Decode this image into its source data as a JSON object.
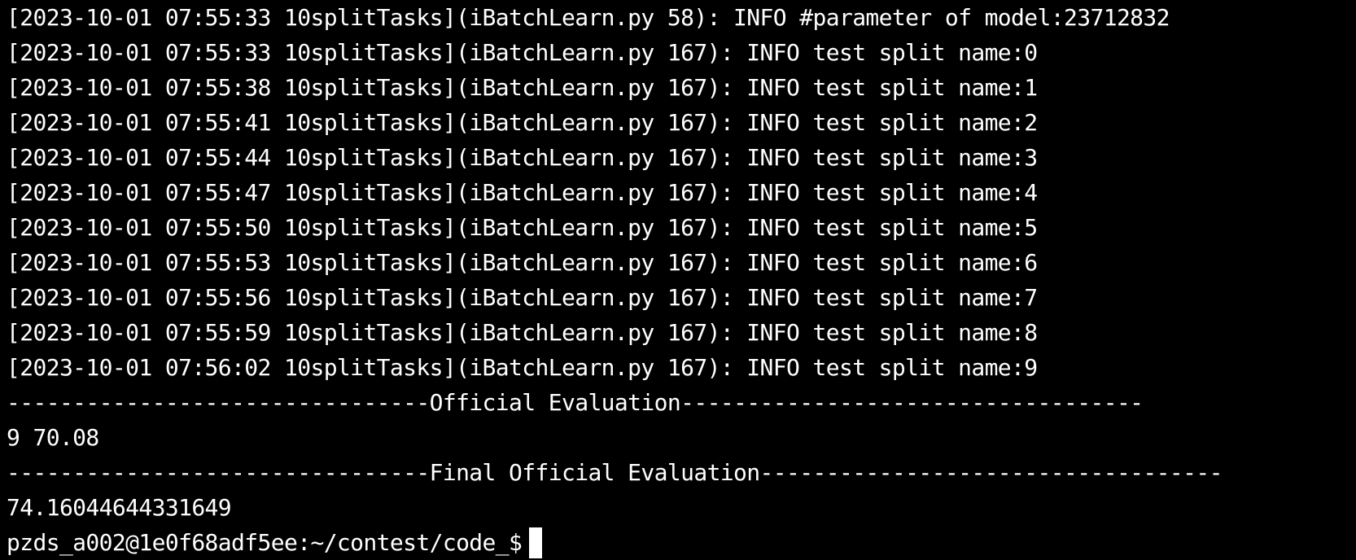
{
  "terminal": {
    "lines": [
      "[2023-10-01 07:55:33 10splitTasks](iBatchLearn.py 58): INFO #parameter of model:23712832",
      "[2023-10-01 07:55:33 10splitTasks](iBatchLearn.py 167): INFO test split name:0",
      "[2023-10-01 07:55:38 10splitTasks](iBatchLearn.py 167): INFO test split name:1",
      "[2023-10-01 07:55:41 10splitTasks](iBatchLearn.py 167): INFO test split name:2",
      "[2023-10-01 07:55:44 10splitTasks](iBatchLearn.py 167): INFO test split name:3",
      "[2023-10-01 07:55:47 10splitTasks](iBatchLearn.py 167): INFO test split name:4",
      "[2023-10-01 07:55:50 10splitTasks](iBatchLearn.py 167): INFO test split name:5",
      "[2023-10-01 07:55:53 10splitTasks](iBatchLearn.py 167): INFO test split name:6",
      "[2023-10-01 07:55:56 10splitTasks](iBatchLearn.py 167): INFO test split name:7",
      "[2023-10-01 07:55:59 10splitTasks](iBatchLearn.py 167): INFO test split name:8",
      "[2023-10-01 07:56:02 10splitTasks](iBatchLearn.py 167): INFO test split name:9",
      "--------------------------------Official Evaluation-----------------------------------",
      "9 70.08",
      "--------------------------------Final Official Evaluation-----------------------------------",
      "74.16044644331649"
    ],
    "prompt": "pzds_a002@1e0f68adf5ee:~/contest/code_$",
    "colors": {
      "background": "#000000",
      "foreground": "#ffffff",
      "cursor": "#ffffff"
    }
  }
}
